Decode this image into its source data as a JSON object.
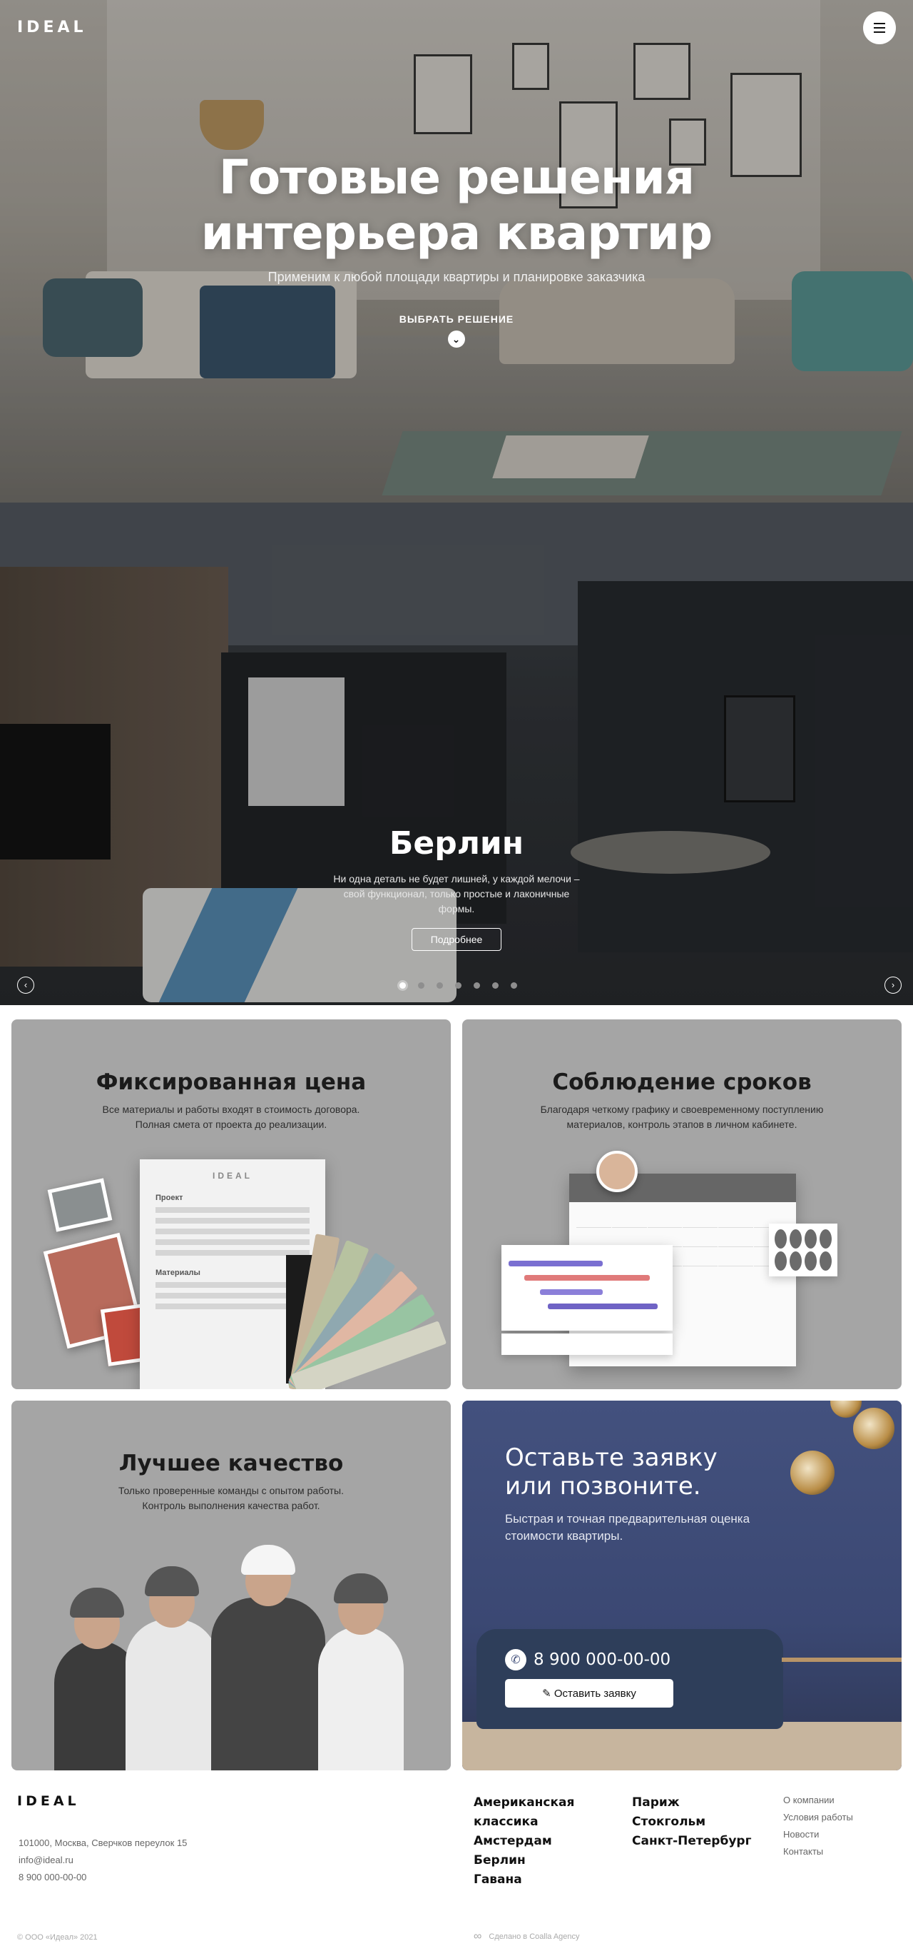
{
  "header": {
    "logo": "IDEAL",
    "menu_icon": "hamburger-menu-icon"
  },
  "hero": {
    "title_line1": "Готовые решения",
    "title_line2": "интерьера квартир",
    "subtitle": "Применим к любой площади квартиры и планировке заказчика",
    "cta_label": "ВЫБРАТЬ РЕШЕНИЕ",
    "cta_icon": "chevron-down-icon"
  },
  "slider": {
    "title": "Берлин",
    "description": "Ни одна деталь не будет лишней, у каждой мелочи – свой функционал, только простые и лаконичные формы.",
    "button_label": "Подробнее",
    "prev_icon": "arrow-left-icon",
    "next_icon": "arrow-right-icon",
    "slides_count": 7,
    "active_slide": 1
  },
  "features": [
    {
      "title": "Фиксированная цена",
      "desc_line1": "Все материалы и работы входят в стоимость договора.",
      "desc_line2": "Полная смета от проекта до реализации.",
      "doc_logo": "IDEAL",
      "doc_section1": "Проект",
      "doc_section2": "Материалы"
    },
    {
      "title": "Соблюдение сроков",
      "desc_line1": "Благодаря четкому графику и своевременному поступлению",
      "desc_line2": "материалов, контроль этапов в личном кабинете."
    },
    {
      "title": "Лучшее качество",
      "desc_line1": "Только проверенные команды с опытом работы.",
      "desc_line2": "Контроль выполнения качества работ."
    }
  ],
  "cta": {
    "title_line1": "Оставьте заявку",
    "title_line2": "или позвоните.",
    "text_line1": "Быстрая и точная предварительная оценка",
    "text_line2": "стоимости квартиры.",
    "phone": "8 900 000-00-00",
    "phone_icon": "phone-icon",
    "button_label": "Оставить заявку",
    "button_icon": "pencil-icon",
    "accent_color": "#3f4d78"
  },
  "footer": {
    "logo": "IDEAL",
    "address": "101000, Москва, Сверчков переулок 15",
    "email": "info@ideal.ru",
    "phone": "8 900 000-00-00",
    "cities_col1": [
      "Американская классика",
      "Амстердам",
      "Берлин",
      "Гавана"
    ],
    "cities_col2": [
      "Париж",
      "Стокгольм",
      "Санкт-Петербург"
    ],
    "links": [
      "О компании",
      "Условия работы",
      "Новости",
      "Контакты"
    ],
    "copyright": "© ООО «Идеал» 2021",
    "made_by": "Сделано в Coalla Agency"
  }
}
